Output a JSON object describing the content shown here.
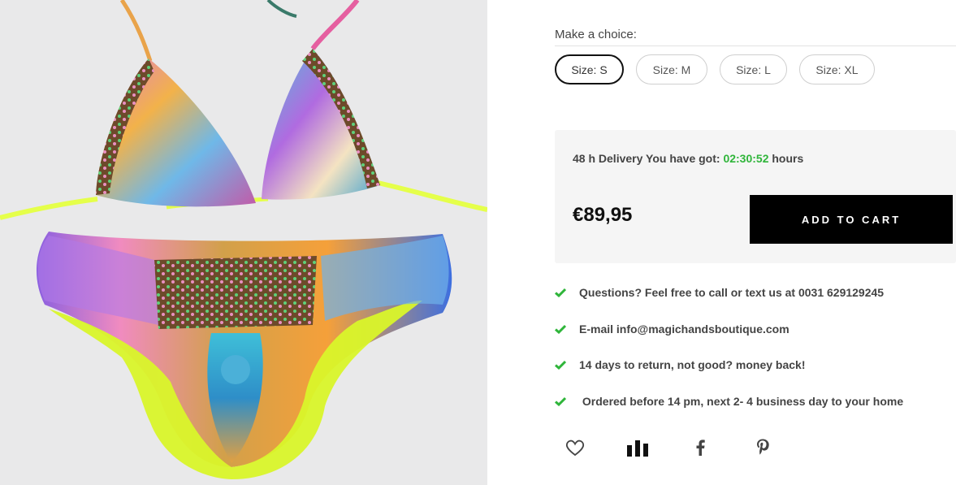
{
  "product_image": {
    "alt": "Colorful printed bikini with neon yellow straps"
  },
  "options": {
    "label": "Make a choice:",
    "sizes": [
      {
        "label": "Size: S",
        "selected": true
      },
      {
        "label": "Size: M",
        "selected": false
      },
      {
        "label": "Size: L",
        "selected": false
      },
      {
        "label": "Size: XL",
        "selected": false
      }
    ]
  },
  "purchase": {
    "delivery_prefix": "48 h Delivery You have got:",
    "timer": "02:30:52",
    "delivery_suffix": "hours",
    "price": "€89,95",
    "add_to_cart_label": "ADD TO CART"
  },
  "usps": [
    "Questions? Feel free to call or text us at 0031 629129245",
    "E-mail info@magichandsboutique.com",
    "14 days to return, not good? money back!",
    " Ordered before 14 pm, next 2- 4 business day to your home"
  ],
  "actions": [
    {
      "icon": "heart-icon"
    },
    {
      "icon": "compare-icon"
    },
    {
      "icon": "facebook-icon"
    },
    {
      "icon": "pinterest-icon"
    }
  ],
  "colors": {
    "accent_green": "#2fb53a",
    "button_black": "#000000",
    "panel_bg": "#f5f5f5"
  }
}
